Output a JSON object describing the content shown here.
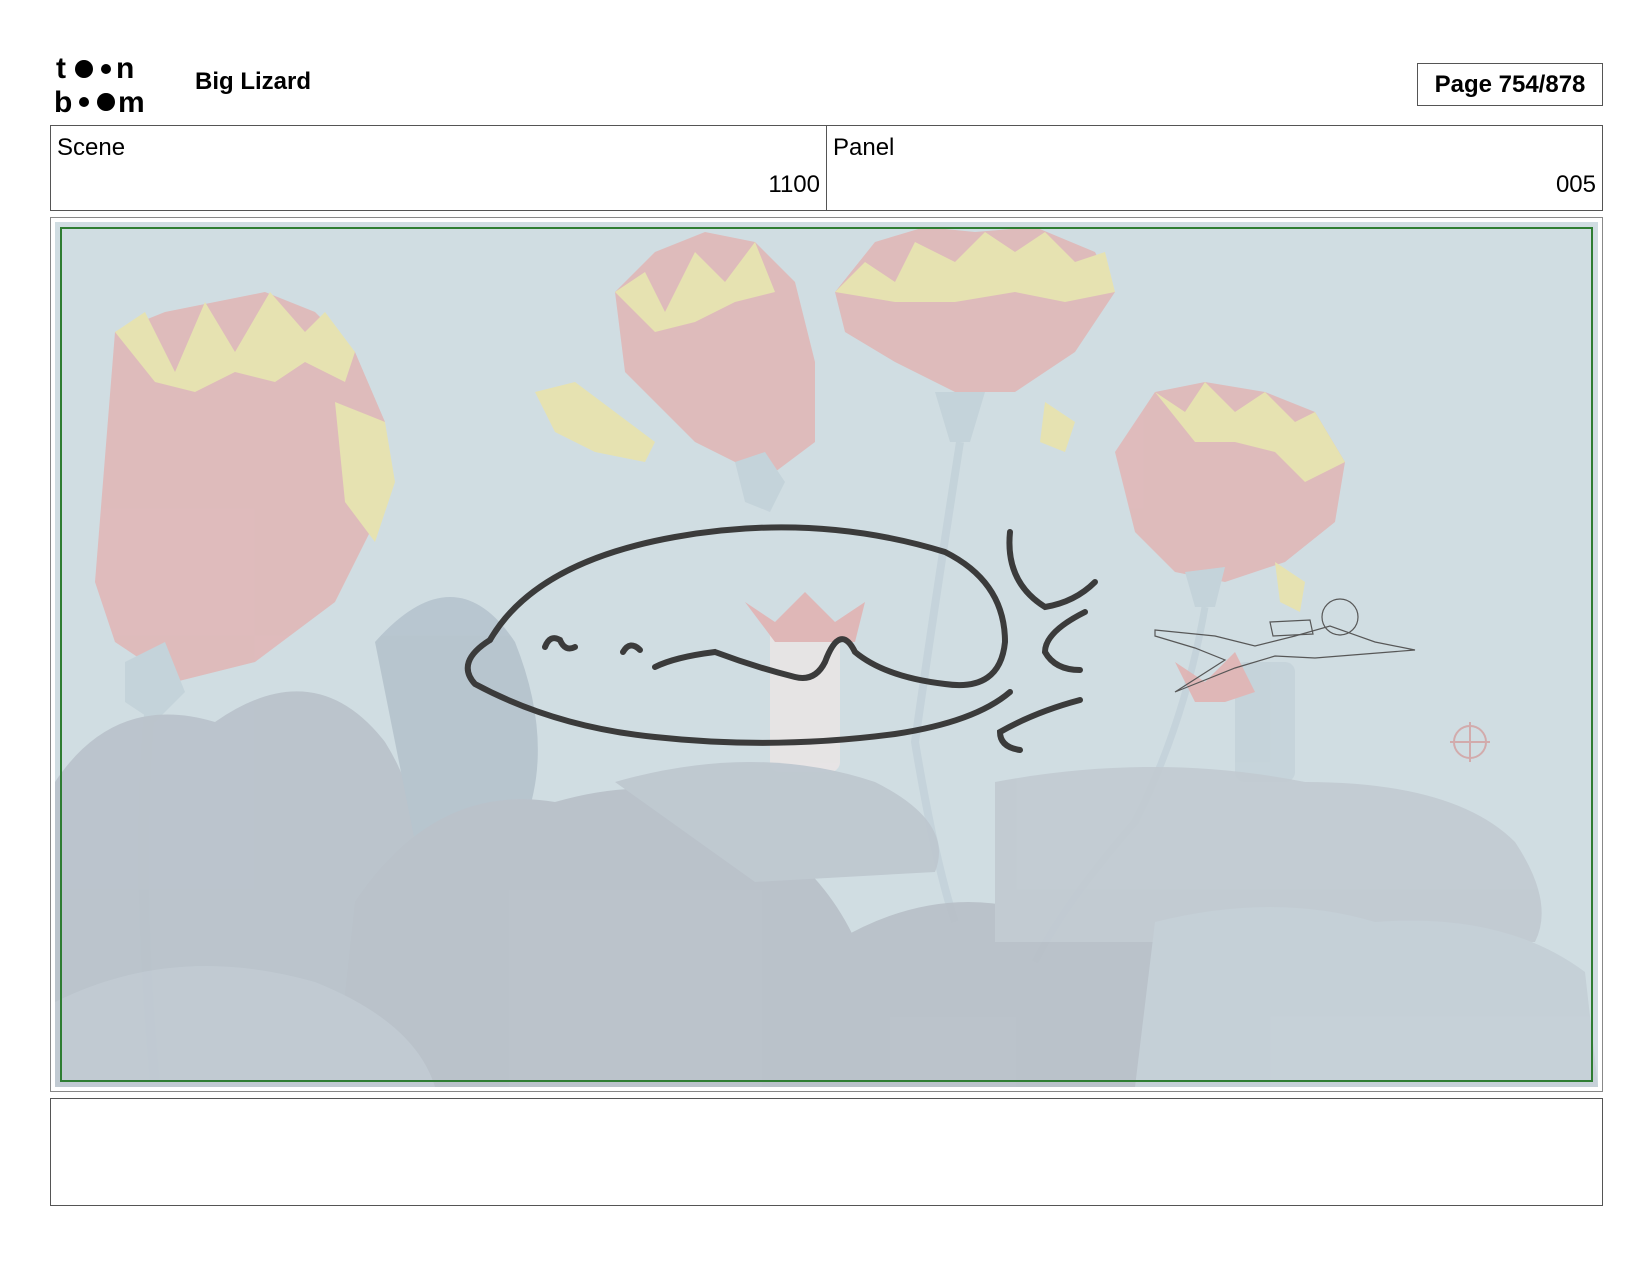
{
  "header": {
    "logo_text": [
      "to",
      "n",
      "b",
      "m"
    ],
    "project_title": "Big Lizard",
    "page_label": "Page",
    "page_value": "754/878"
  },
  "info": {
    "scene_label": "Scene",
    "scene_value": "1100",
    "panel_label": "Panel",
    "panel_value": "005"
  },
  "panel_image": {
    "icon": "storyboard-panel-image",
    "safe_area_color": "#2e7d32",
    "water_color": "#c6d6dc",
    "coral_red": "#d9a8a8",
    "coral_yellow": "#e4dd9a",
    "rock_color": "#aab5bf"
  },
  "notes": {
    "text": ""
  }
}
